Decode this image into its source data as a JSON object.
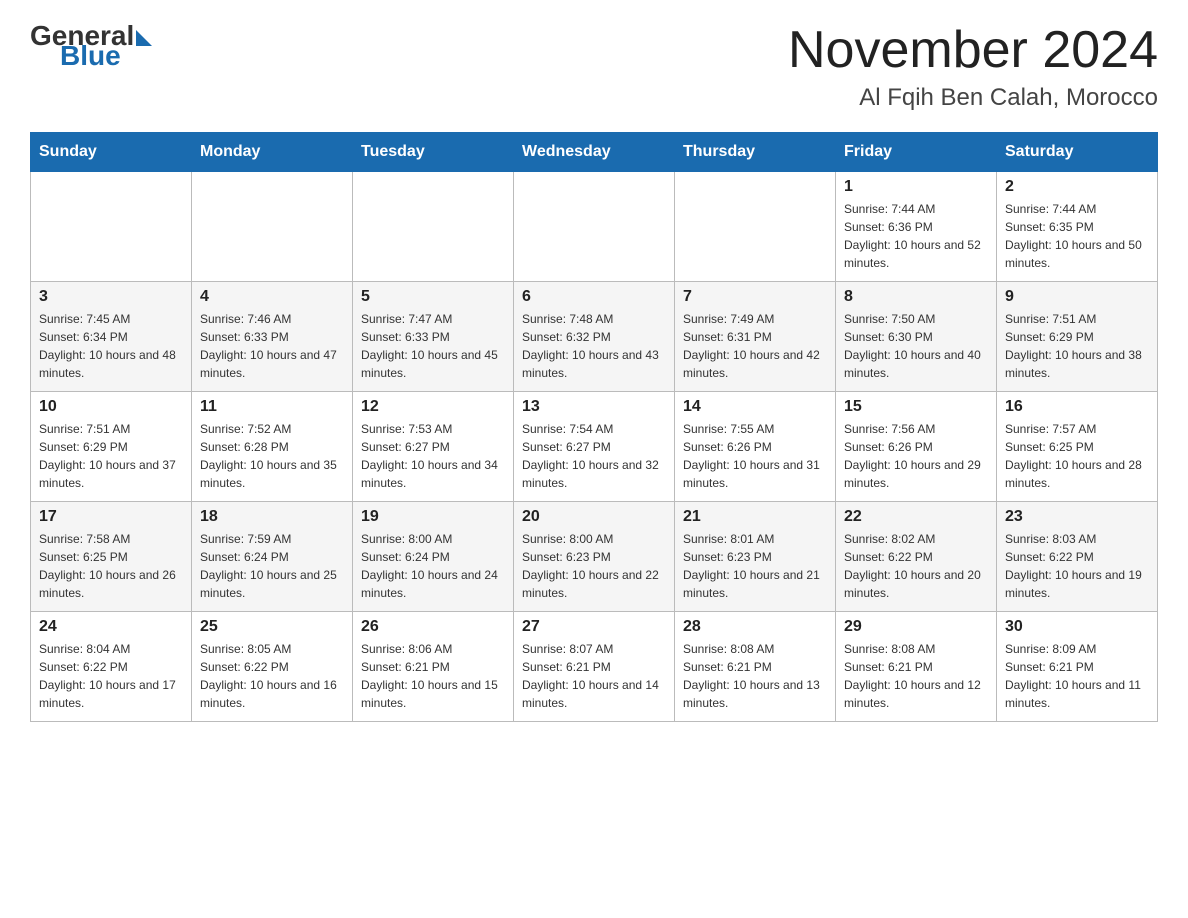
{
  "header": {
    "logo": {
      "general": "General",
      "blue": "Blue"
    },
    "title": "November 2024",
    "subtitle": "Al Fqih Ben Calah, Morocco"
  },
  "days_of_week": [
    "Sunday",
    "Monday",
    "Tuesday",
    "Wednesday",
    "Thursday",
    "Friday",
    "Saturday"
  ],
  "weeks": [
    {
      "days": [
        {
          "num": "",
          "info": ""
        },
        {
          "num": "",
          "info": ""
        },
        {
          "num": "",
          "info": ""
        },
        {
          "num": "",
          "info": ""
        },
        {
          "num": "",
          "info": ""
        },
        {
          "num": "1",
          "info": "Sunrise: 7:44 AM\nSunset: 6:36 PM\nDaylight: 10 hours and 52 minutes."
        },
        {
          "num": "2",
          "info": "Sunrise: 7:44 AM\nSunset: 6:35 PM\nDaylight: 10 hours and 50 minutes."
        }
      ]
    },
    {
      "days": [
        {
          "num": "3",
          "info": "Sunrise: 7:45 AM\nSunset: 6:34 PM\nDaylight: 10 hours and 48 minutes."
        },
        {
          "num": "4",
          "info": "Sunrise: 7:46 AM\nSunset: 6:33 PM\nDaylight: 10 hours and 47 minutes."
        },
        {
          "num": "5",
          "info": "Sunrise: 7:47 AM\nSunset: 6:33 PM\nDaylight: 10 hours and 45 minutes."
        },
        {
          "num": "6",
          "info": "Sunrise: 7:48 AM\nSunset: 6:32 PM\nDaylight: 10 hours and 43 minutes."
        },
        {
          "num": "7",
          "info": "Sunrise: 7:49 AM\nSunset: 6:31 PM\nDaylight: 10 hours and 42 minutes."
        },
        {
          "num": "8",
          "info": "Sunrise: 7:50 AM\nSunset: 6:30 PM\nDaylight: 10 hours and 40 minutes."
        },
        {
          "num": "9",
          "info": "Sunrise: 7:51 AM\nSunset: 6:29 PM\nDaylight: 10 hours and 38 minutes."
        }
      ]
    },
    {
      "days": [
        {
          "num": "10",
          "info": "Sunrise: 7:51 AM\nSunset: 6:29 PM\nDaylight: 10 hours and 37 minutes."
        },
        {
          "num": "11",
          "info": "Sunrise: 7:52 AM\nSunset: 6:28 PM\nDaylight: 10 hours and 35 minutes."
        },
        {
          "num": "12",
          "info": "Sunrise: 7:53 AM\nSunset: 6:27 PM\nDaylight: 10 hours and 34 minutes."
        },
        {
          "num": "13",
          "info": "Sunrise: 7:54 AM\nSunset: 6:27 PM\nDaylight: 10 hours and 32 minutes."
        },
        {
          "num": "14",
          "info": "Sunrise: 7:55 AM\nSunset: 6:26 PM\nDaylight: 10 hours and 31 minutes."
        },
        {
          "num": "15",
          "info": "Sunrise: 7:56 AM\nSunset: 6:26 PM\nDaylight: 10 hours and 29 minutes."
        },
        {
          "num": "16",
          "info": "Sunrise: 7:57 AM\nSunset: 6:25 PM\nDaylight: 10 hours and 28 minutes."
        }
      ]
    },
    {
      "days": [
        {
          "num": "17",
          "info": "Sunrise: 7:58 AM\nSunset: 6:25 PM\nDaylight: 10 hours and 26 minutes."
        },
        {
          "num": "18",
          "info": "Sunrise: 7:59 AM\nSunset: 6:24 PM\nDaylight: 10 hours and 25 minutes."
        },
        {
          "num": "19",
          "info": "Sunrise: 8:00 AM\nSunset: 6:24 PM\nDaylight: 10 hours and 24 minutes."
        },
        {
          "num": "20",
          "info": "Sunrise: 8:00 AM\nSunset: 6:23 PM\nDaylight: 10 hours and 22 minutes."
        },
        {
          "num": "21",
          "info": "Sunrise: 8:01 AM\nSunset: 6:23 PM\nDaylight: 10 hours and 21 minutes."
        },
        {
          "num": "22",
          "info": "Sunrise: 8:02 AM\nSunset: 6:22 PM\nDaylight: 10 hours and 20 minutes."
        },
        {
          "num": "23",
          "info": "Sunrise: 8:03 AM\nSunset: 6:22 PM\nDaylight: 10 hours and 19 minutes."
        }
      ]
    },
    {
      "days": [
        {
          "num": "24",
          "info": "Sunrise: 8:04 AM\nSunset: 6:22 PM\nDaylight: 10 hours and 17 minutes."
        },
        {
          "num": "25",
          "info": "Sunrise: 8:05 AM\nSunset: 6:22 PM\nDaylight: 10 hours and 16 minutes."
        },
        {
          "num": "26",
          "info": "Sunrise: 8:06 AM\nSunset: 6:21 PM\nDaylight: 10 hours and 15 minutes."
        },
        {
          "num": "27",
          "info": "Sunrise: 8:07 AM\nSunset: 6:21 PM\nDaylight: 10 hours and 14 minutes."
        },
        {
          "num": "28",
          "info": "Sunrise: 8:08 AM\nSunset: 6:21 PM\nDaylight: 10 hours and 13 minutes."
        },
        {
          "num": "29",
          "info": "Sunrise: 8:08 AM\nSunset: 6:21 PM\nDaylight: 10 hours and 12 minutes."
        },
        {
          "num": "30",
          "info": "Sunrise: 8:09 AM\nSunset: 6:21 PM\nDaylight: 10 hours and 11 minutes."
        }
      ]
    }
  ]
}
